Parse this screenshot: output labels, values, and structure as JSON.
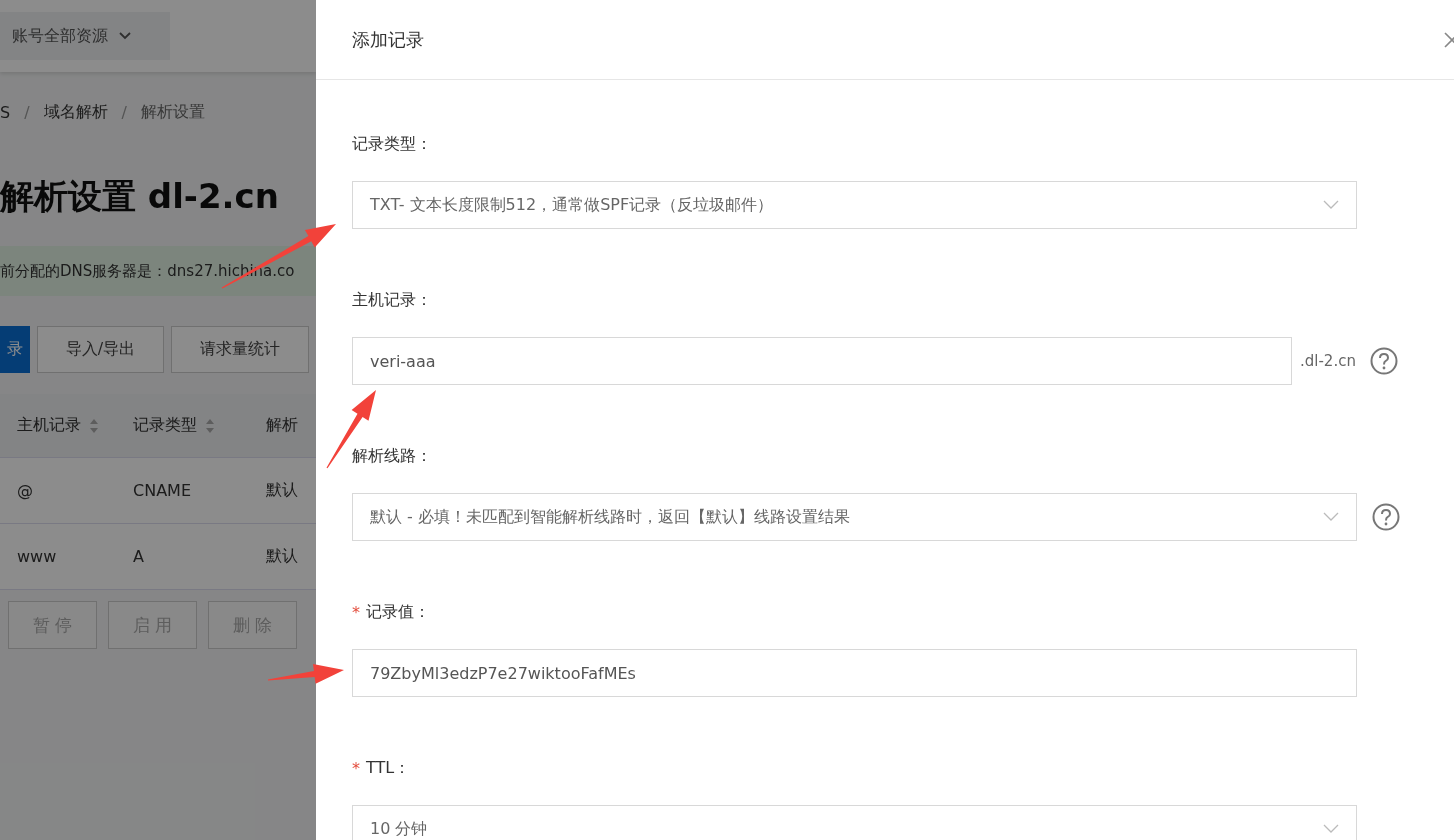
{
  "top_bar": {
    "scope_dropdown": "账号全部资源"
  },
  "breadcrumb": [
    {
      "label": "S"
    },
    {
      "separator": "/",
      "label": "域名解析"
    },
    {
      "separator": "/",
      "label": "解析设置"
    }
  ],
  "page_title": "解析设置 dl-2.cn",
  "dns_notice": "前分配的DNS服务器是：dns27.hichina.co",
  "toolbar_buttons": [
    {
      "label": "录",
      "primary": true
    },
    {
      "label": "导入/导出",
      "primary": false
    },
    {
      "label": "请求量统计",
      "primary": false
    }
  ],
  "table": {
    "columns": [
      {
        "label": "主机记录",
        "sortable": true
      },
      {
        "label": "记录类型",
        "sortable": true
      },
      {
        "label": "解析",
        "sortable": false
      }
    ],
    "rows": [
      [
        "@",
        "CNAME",
        "默认"
      ],
      [
        "www",
        "A",
        "默认"
      ]
    ]
  },
  "batch_buttons": [
    {
      "label": "暂 停",
      "disabled": true
    },
    {
      "label": "启 用",
      "disabled": true
    },
    {
      "label": "删 除",
      "disabled": true
    }
  ],
  "drawer": {
    "title": "添加记录",
    "fields": [
      {
        "label": "记录类型：",
        "kind": "select",
        "value": "TXT- 文本长度限制512，通常做SPF记录（反垃圾邮件）",
        "help": false
      },
      {
        "label": "主机记录：",
        "kind": "input",
        "value": "veri-aaa",
        "suffix": ".dl-2.cn",
        "help": true
      },
      {
        "label": "解析线路：",
        "kind": "select",
        "value": "默认 - 必填！未匹配到智能解析线路时，返回【默认】线路设置结果",
        "help": true
      },
      {
        "label": "记录值：",
        "required_mark": "*",
        "kind": "input",
        "value": "79ZbyMl3edzP7e27wiktooFafMEs",
        "help": false
      },
      {
        "label": "TTL：",
        "required_mark": "*",
        "kind": "select",
        "value": "10 分钟",
        "help": false
      }
    ]
  }
}
